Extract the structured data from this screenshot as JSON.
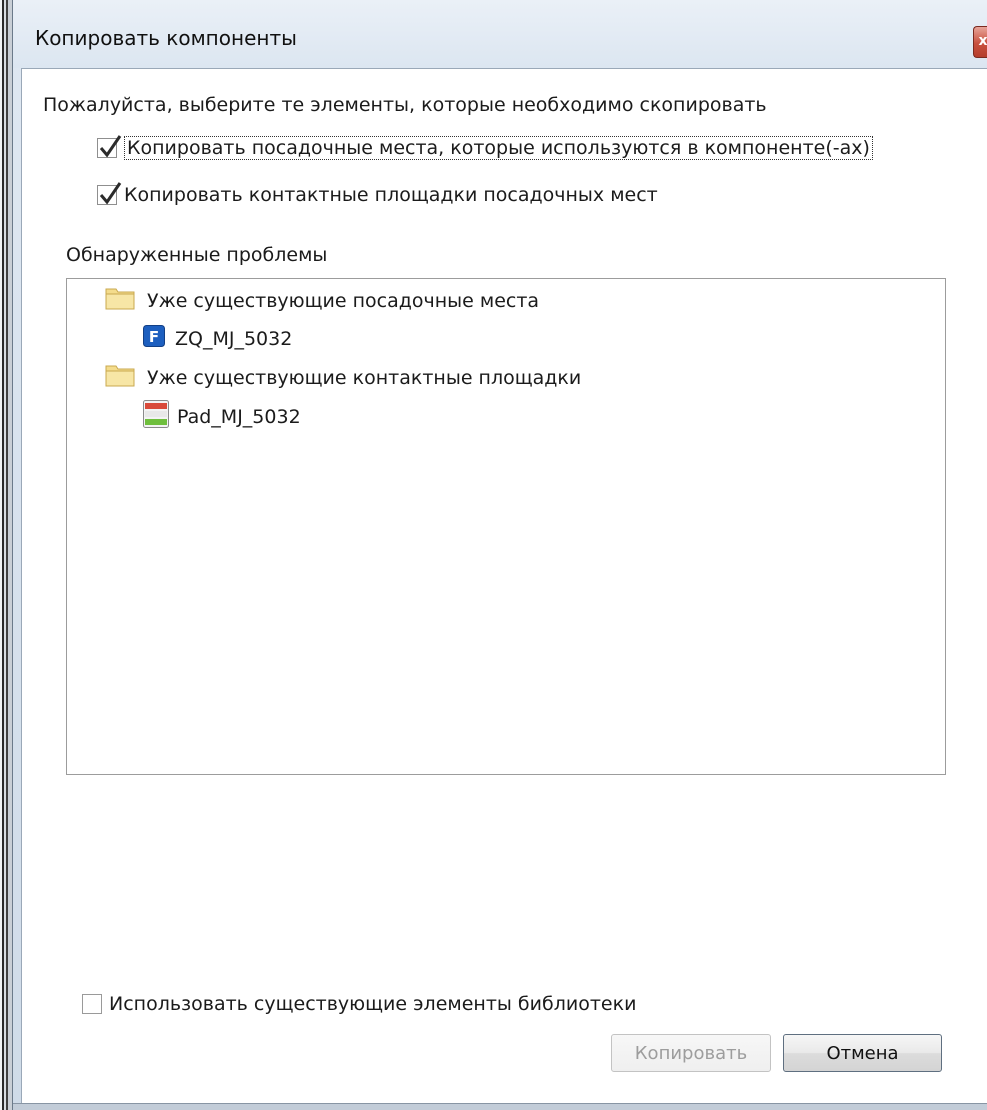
{
  "window": {
    "title": "Копировать компоненты",
    "close_label": "x"
  },
  "prompt": "Пожалуйста, выберите те элементы, которые необходимо скопировать",
  "options": [
    {
      "label": "Копировать посадочные места, которые используются в компоненте(-ах)",
      "checked": true
    },
    {
      "label": "Копировать контактные площадки посадочных мест",
      "checked": true
    }
  ],
  "problems": {
    "label": "Обнаруженные проблемы",
    "tree": [
      {
        "label": "Уже существующие посадочные места",
        "icon": "folder-icon"
      },
      {
        "label": "ZQ_MJ_5032",
        "icon": "footprint-icon",
        "badge": "F"
      },
      {
        "label": "Уже существующие контактные площадки",
        "icon": "folder-icon"
      },
      {
        "label": "Pad_MJ_5032",
        "icon": "pad-icon"
      }
    ]
  },
  "use_existing": {
    "label": "Использовать существующие элементы библиотеки",
    "checked": false
  },
  "buttons": {
    "copy": {
      "label": "Копировать",
      "enabled": false
    },
    "cancel": {
      "label": "Отмена",
      "enabled": true
    }
  }
}
